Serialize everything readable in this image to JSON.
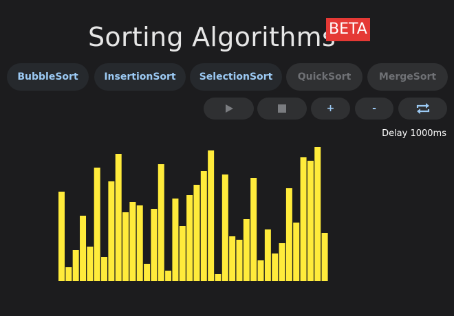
{
  "header": {
    "title": "Sorting Algorithms",
    "badge": "BETA"
  },
  "algorithms": [
    {
      "label": "BubbleSort",
      "enabled": true
    },
    {
      "label": "InsertionSort",
      "enabled": true
    },
    {
      "label": "SelectionSort",
      "enabled": true
    },
    {
      "label": "QuickSort",
      "enabled": false
    },
    {
      "label": "MergeSort",
      "enabled": false
    }
  ],
  "controls": {
    "play_icon": "play-icon",
    "stop_icon": "stop-icon",
    "increase_label": "+",
    "decrease_label": "-",
    "shuffle_icon": "repeat-icon"
  },
  "delay_text": "Delay 1000ms",
  "colors": {
    "bar": "#ffeb3b",
    "accent": "#9ccaf4",
    "badge": "#e53935",
    "background": "#1c1c1e"
  },
  "chart_data": {
    "type": "bar",
    "values": [
      26,
      4,
      9,
      19,
      10,
      33,
      7,
      29,
      37,
      20,
      23,
      22,
      5,
      21,
      34,
      3,
      24,
      16,
      25,
      28,
      32,
      38,
      2,
      31,
      13,
      12,
      18,
      30,
      6,
      15,
      8,
      11,
      27,
      17,
      36,
      35,
      39,
      14
    ],
    "ylim": [
      0,
      40
    ]
  }
}
